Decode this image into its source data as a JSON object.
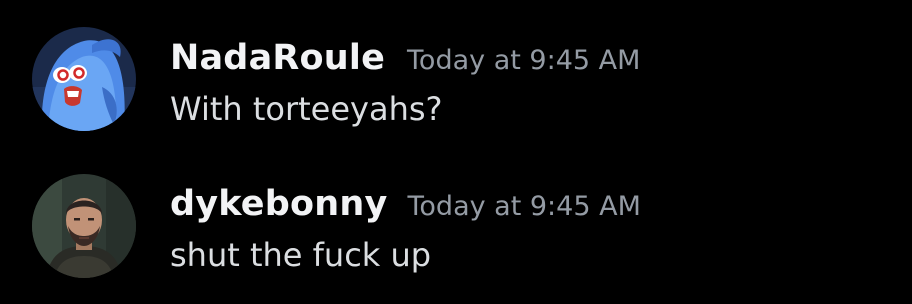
{
  "messages": [
    {
      "author": "NadaRoule",
      "timestamp": "Today at 9:45 AM",
      "content": "With torteeyahs?",
      "avatar_icon": "blue-cartoon-fish-avatar"
    },
    {
      "author": "dykebonny",
      "timestamp": "Today at 9:45 AM",
      "content": "shut the fuck up",
      "avatar_icon": "bearded-man-photo-avatar"
    }
  ],
  "colors": {
    "background": "#000000",
    "username": "#f2f3f5",
    "timestamp": "#949ba4",
    "message_text": "#dbdee1"
  }
}
